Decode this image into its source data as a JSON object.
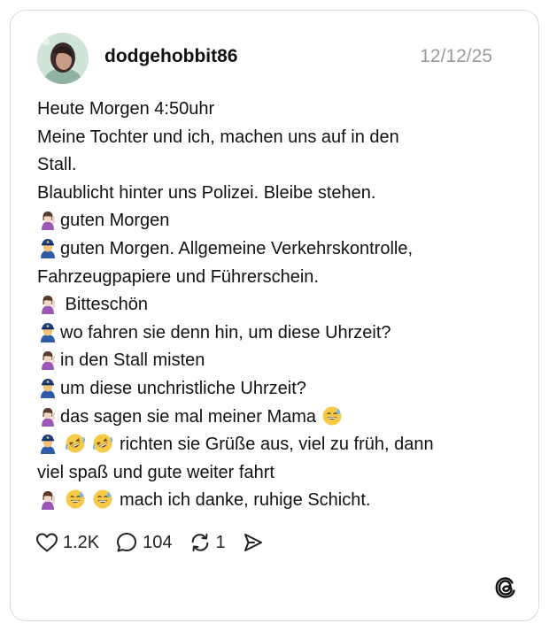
{
  "post": {
    "username": "dodgehobbit86",
    "date": "12/12/25",
    "lines": [
      {
        "emoji": [],
        "text": "Heute Morgen 4:50uhr"
      },
      {
        "emoji": [],
        "text": "Meine Tochter und ich, machen uns auf in den"
      },
      {
        "emoji": [],
        "text": "Stall."
      },
      {
        "emoji": [],
        "text": "Blaublicht hinter uns Polizei. Bleibe stehen."
      },
      {
        "emoji": [
          "woman-raising-hand-icon"
        ],
        "text": "guten Morgen"
      },
      {
        "emoji": [
          "police-officer-icon"
        ],
        "text": "guten Morgen. Allgemeine Verkehrskontrolle,"
      },
      {
        "emoji": [],
        "text": "Fahrzeugpapiere und Führerschein."
      },
      {
        "emoji": [
          "woman-raising-hand-icon"
        ],
        "text": " Bitteschön"
      },
      {
        "emoji": [
          "police-officer-icon"
        ],
        "text": "wo fahren sie denn hin, um diese Uhrzeit?"
      },
      {
        "emoji": [
          "woman-raising-hand-icon"
        ],
        "text": "in den Stall misten"
      },
      {
        "emoji": [
          "police-officer-icon"
        ],
        "text": "um diese unchristliche Uhrzeit?"
      },
      {
        "emoji": [
          "woman-raising-hand-icon"
        ],
        "text": "das sagen sie mal meiner Mama",
        "trailing_emoji": [
          "grinning-sweat-icon"
        ]
      },
      {
        "emoji": [
          "police-officer-icon",
          "rolling-laughing-icon",
          "rolling-laughing-icon"
        ],
        "text": "richten sie Grüße aus, viel zu früh, dann"
      },
      {
        "emoji": [],
        "text": "viel spaß und gute weiter fahrt"
      },
      {
        "emoji": [
          "woman-raising-hand-icon",
          "grinning-sweat-icon",
          "grinning-sweat-icon"
        ],
        "text": "mach ich danke, ruhige Schicht."
      }
    ]
  },
  "actions": {
    "likes": "1.2K",
    "replies": "104",
    "reposts": "1"
  },
  "icons": {
    "like": "heart-icon",
    "reply": "speech-bubble-icon",
    "repost": "repost-icon",
    "share": "send-icon",
    "brand": "threads-logo-icon"
  }
}
